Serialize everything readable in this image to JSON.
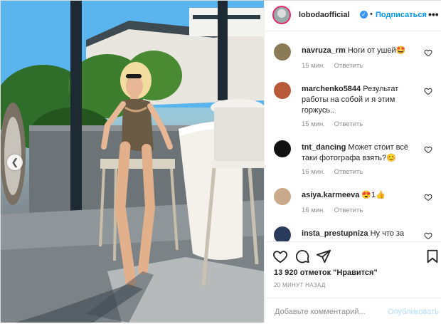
{
  "post": {
    "username": "lobodaofficial",
    "separator": "•",
    "follow_label": "Подписаться",
    "more_label": "•••",
    "verified_icon": "verified-badge-icon",
    "prev_icon": "chevron-left-icon"
  },
  "comments": [
    {
      "user": "navruza_rm",
      "text": "Ноги от ушей🤩",
      "time": "15 мин.",
      "reply": "Ответить",
      "avatar_color": "#8a7a55"
    },
    {
      "user": "marchenko5844",
      "text": "Результат работы на собой и я этим горжусь..",
      "time": "15 мин.",
      "reply": "Ответить",
      "avatar_color": "#b85a3a"
    },
    {
      "user": "tnt_dancing",
      "text": "Может стоит всё таки фотографа взять?😊",
      "time": "16 мин.",
      "reply": "Ответить",
      "avatar_color": "#111111"
    },
    {
      "user": "asiya.karmeeva",
      "text": "😍1👍",
      "time": "16 мин.",
      "reply": "Ответить",
      "avatar_color": "#c9a98c"
    },
    {
      "user": "insta_prestupniza",
      "text": "Ну что за",
      "time": "",
      "reply": "",
      "avatar_color": "#2a3a5a"
    }
  ],
  "actions": {
    "likes": "13 920 отметок \"Нравится\"",
    "time_ago": "20 МИНУТ НАЗАД",
    "comment_placeholder": "Добавьте комментарий...",
    "publish_label": "Опубликовать"
  },
  "colors": {
    "link_blue": "#0095f6",
    "publish_disabled": "#b2dffc",
    "meta_gray": "#8e8e8e"
  }
}
